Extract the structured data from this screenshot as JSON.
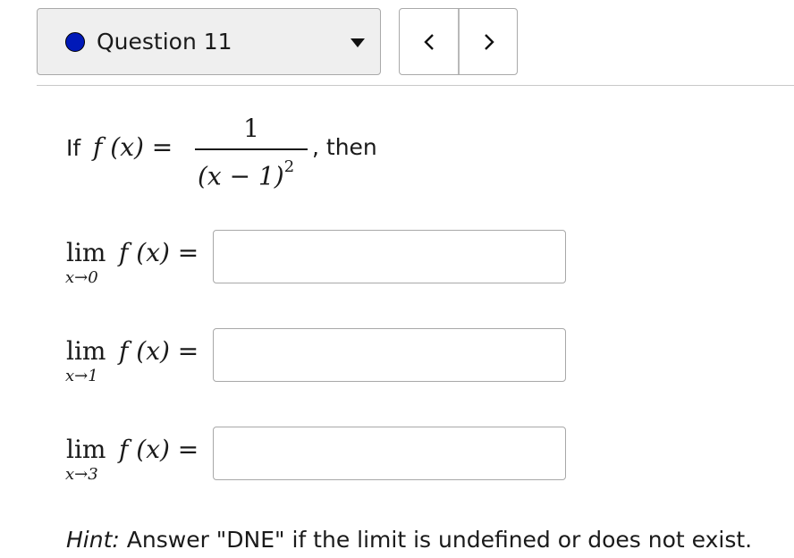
{
  "question_nav": {
    "title": "Question 11",
    "status_color": "#0019b8",
    "dropdown_icon": "caret-down-icon",
    "prev_icon": "chevron-left-icon",
    "next_icon": "chevron-right-icon"
  },
  "statement": {
    "if_label": "If",
    "lhs": "f (x) =",
    "numerator": "1",
    "denominator_base": "(x − 1)",
    "denominator_exp": "2",
    "then_label": ", then"
  },
  "limits": [
    {
      "lim": "lim",
      "approach": "x→0",
      "func": "f (x) =",
      "answer": ""
    },
    {
      "lim": "lim",
      "approach": "x→1",
      "func": "f (x) =",
      "answer": ""
    },
    {
      "lim": "lim",
      "approach": "x→3",
      "func": "f (x) =",
      "answer": ""
    }
  ],
  "hint": {
    "label": "Hint:",
    "text": " Answer \"DNE\" if the limit is undefined or does not exist."
  }
}
